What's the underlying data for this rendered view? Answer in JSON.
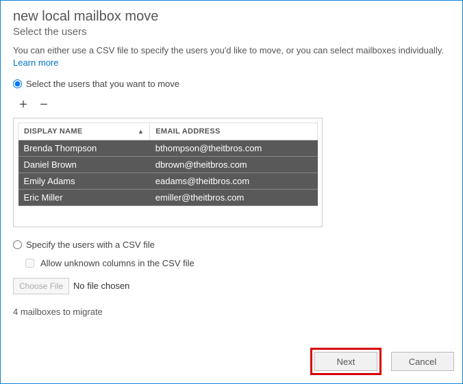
{
  "title": "new local mailbox move",
  "subtitle": "Select the users",
  "description_pre": "You can either use a CSV file to specify the users you'd like to move, or you can select mailboxes individually. ",
  "learn_more": "Learn more",
  "radio_select_label": "Select the users that you want to move",
  "radio_csv_label": "Specify the users with a CSV file",
  "toolbar": {
    "add_tip": "Add",
    "remove_tip": "Remove"
  },
  "table": {
    "columns": {
      "display_name": "DISPLAY NAME",
      "email": "EMAIL ADDRESS"
    },
    "rows": [
      {
        "name": "Brenda Thompson",
        "email": "bthompson@theitbros.com"
      },
      {
        "name": "Daniel Brown",
        "email": "dbrown@theitbros.com"
      },
      {
        "name": "Emily Adams",
        "email": "eadams@theitbros.com"
      },
      {
        "name": "Eric Miller",
        "email": "emiller@theitbros.com"
      }
    ]
  },
  "csv": {
    "allow_unknown_label": "Allow unknown columns in the CSV file",
    "choose_file_label": "Choose File",
    "no_file_chosen": "No file chosen"
  },
  "status_line": "4 mailboxes to migrate",
  "buttons": {
    "next": "Next",
    "cancel": "Cancel"
  }
}
